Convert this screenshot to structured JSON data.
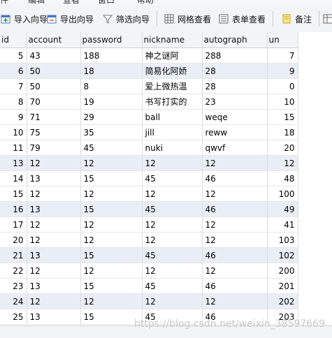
{
  "menu": {
    "items": [
      "件",
      "编辑",
      "查看",
      "窗口",
      "帮助"
    ]
  },
  "toolbar": {
    "import_label": "导入向导",
    "export_label": "导出向导",
    "filter_label": "筛选向导",
    "grid_view_label": "网格查看",
    "form_view_label": "表单查看",
    "note_label": "备注"
  },
  "table": {
    "columns": [
      "id",
      "account",
      "password",
      "nickname",
      "autograph",
      "un"
    ],
    "rows": [
      [
        "5",
        "43",
        "188",
        "神之谜阿",
        "288",
        "7"
      ],
      [
        "6",
        "50",
        "18",
        "简易化阿娇",
        "28",
        "9"
      ],
      [
        "7",
        "50",
        "8",
        "爱上微热温",
        "28",
        "0"
      ],
      [
        "8",
        "70",
        "19",
        "书写打实的",
        "23",
        "10"
      ],
      [
        "9",
        "71",
        "29",
        "ball",
        "weqe",
        "15"
      ],
      [
        "10",
        "75",
        "35",
        "jill",
        "reww",
        "18"
      ],
      [
        "11",
        "79",
        "45",
        "nuki",
        "qwvf",
        "20"
      ],
      [
        "13",
        "12",
        "12",
        "12",
        "12",
        "12"
      ],
      [
        "14",
        "13",
        "15",
        "45",
        "46",
        "48"
      ],
      [
        "15",
        "12",
        "12",
        "12",
        "12",
        "100"
      ],
      [
        "16",
        "13",
        "15",
        "45",
        "46",
        "49"
      ],
      [
        "17",
        "12",
        "12",
        "12",
        "12",
        "41"
      ],
      [
        "20",
        "12",
        "12",
        "12",
        "12",
        "103"
      ],
      [
        "21",
        "13",
        "15",
        "45",
        "46",
        "102"
      ],
      [
        "22",
        "12",
        "12",
        "12",
        "12",
        "200"
      ],
      [
        "23",
        "13",
        "15",
        "45",
        "46",
        "201"
      ],
      [
        "24",
        "12",
        "12",
        "12",
        "12",
        "202"
      ],
      [
        "25",
        "13",
        "15",
        "45",
        "46",
        "203"
      ]
    ]
  },
  "watermark": "https://blog.csdn.net/weixin_38597669",
  "colors": {
    "shaded_row": "#e9eef6",
    "header_bg": "#f3f4f6"
  }
}
